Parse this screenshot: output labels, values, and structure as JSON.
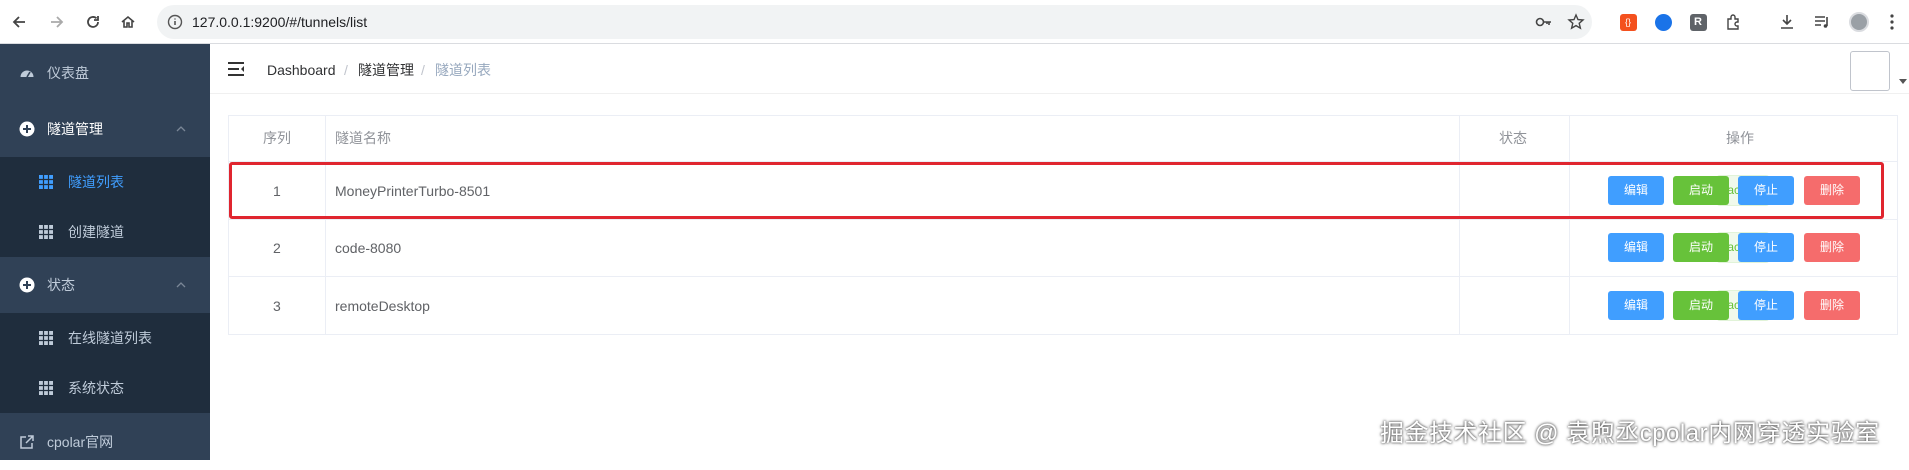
{
  "browser": {
    "url": "127.0.0.1:9200/#/tunnels/list",
    "back_icon": "arrow-left-icon",
    "forward_icon": "arrow-right-icon",
    "reload_icon": "reload-icon",
    "home_icon": "home-icon"
  },
  "sidebar": {
    "items": [
      {
        "label": "仪表盘",
        "icon": "dashboard-icon"
      },
      {
        "label": "隧道管理",
        "icon": "plus-circle-icon",
        "children": [
          {
            "label": "隧道列表",
            "active": true
          },
          {
            "label": "创建隧道"
          }
        ]
      },
      {
        "label": "状态",
        "icon": "plus-circle-icon",
        "children": [
          {
            "label": "在线隧道列表"
          },
          {
            "label": "系统状态"
          }
        ]
      },
      {
        "label": "cpolar官网",
        "icon": "external-link-icon"
      }
    ]
  },
  "breadcrumb": {
    "items": [
      "Dashboard",
      "隧道管理",
      "隧道列表"
    ],
    "separator": "/"
  },
  "table": {
    "headers": {
      "index": "序列",
      "name": "隧道名称",
      "status": "状态",
      "actions": "操作"
    },
    "rows": [
      {
        "index": "1",
        "name": "MoneyPrinterTurbo-8501",
        "status": "active"
      },
      {
        "index": "2",
        "name": "code-8080",
        "status": "active"
      },
      {
        "index": "3",
        "name": "remoteDesktop",
        "status": "active"
      }
    ],
    "actions": {
      "edit": "编辑",
      "start": "启动",
      "stop": "停止",
      "delete": "删除"
    }
  },
  "watermark": "掘金技术社区 @ 袁煦丞cpolar内网穿透实验室",
  "colors": {
    "sidebar_bg": "#304156",
    "submenu_bg": "#1f2d3d",
    "active": "#409eff",
    "success": "#67c23a",
    "danger": "#f56c6c",
    "highlight": "#e0252f"
  }
}
